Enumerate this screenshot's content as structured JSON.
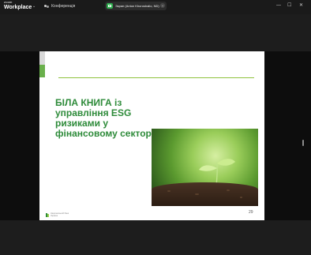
{
  "app": {
    "brand_top": "zoom",
    "brand_bottom": "Workplace"
  },
  "tabs": [
    {
      "label": "Конференція"
    }
  ],
  "share_indicator": {
    "label": "Экран (Anton Khoroshailo, ND)"
  },
  "window_controls": {
    "minimize": "—",
    "maximize": "☐",
    "close": "✕"
  },
  "slide": {
    "title": "БІЛА КНИГА із управління ESG ризиками у фінансовому секторі",
    "page_number": "29",
    "footer_org": "Національний банк України"
  },
  "colors": {
    "title_green": "#2e8b3a",
    "accent_line": "#8fc33d",
    "share_green": "#2fae4f"
  },
  "icons": [
    "chevron-down-icon",
    "conference-icon",
    "screen-share-icon",
    "minimize-icon",
    "maximize-icon",
    "close-icon",
    "nbu-logo-icon"
  ]
}
